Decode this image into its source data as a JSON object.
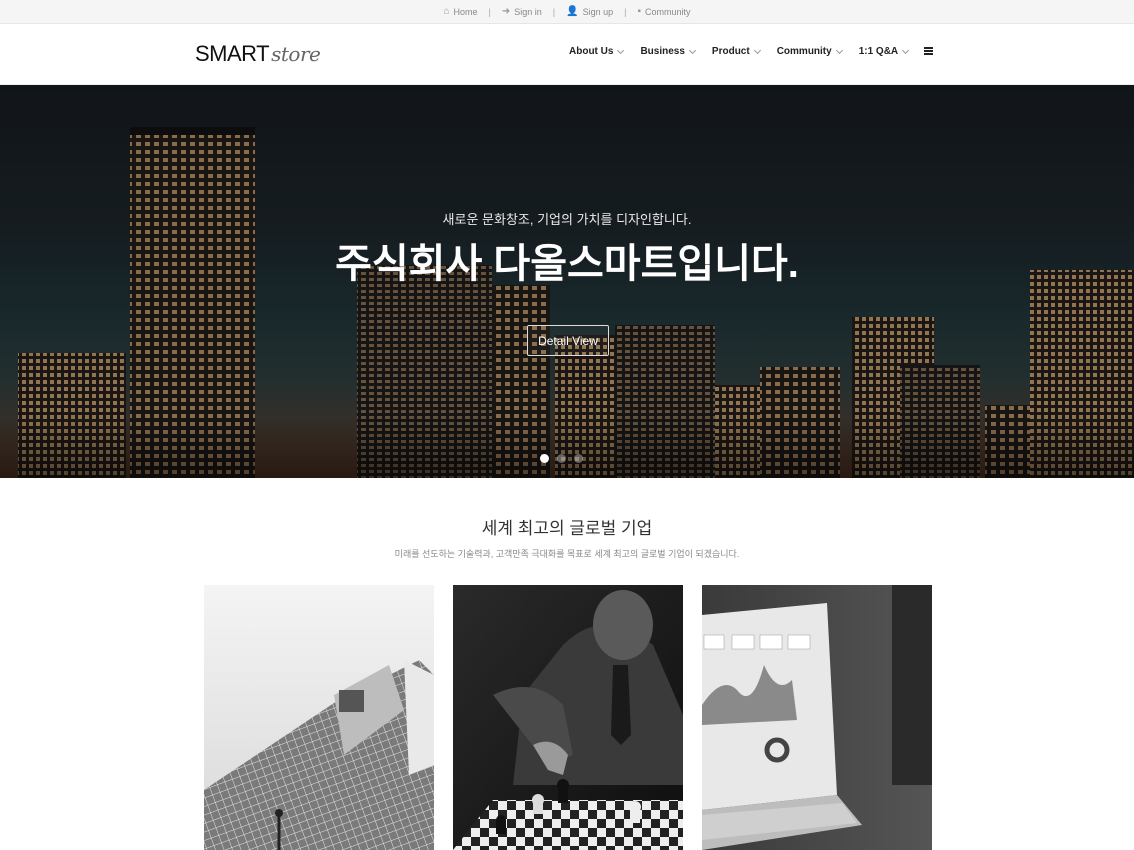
{
  "topbar": {
    "items": [
      {
        "label": "Home",
        "icon": "home-icon"
      },
      {
        "label": "Sign in",
        "icon": "sign-in-icon"
      },
      {
        "label": "Sign up",
        "icon": "user-plus-icon"
      },
      {
        "label": "Community",
        "icon": "comment-icon"
      }
    ],
    "separator": "|"
  },
  "header": {
    "logo_main": "SMART",
    "logo_sub": "store",
    "nav": [
      {
        "label": "About Us"
      },
      {
        "label": "Business"
      },
      {
        "label": "Product"
      },
      {
        "label": "Community"
      },
      {
        "label": "1:1 Q&A"
      }
    ],
    "menu_icon": "hamburger-menu-icon"
  },
  "hero": {
    "subtitle": "새로운 문화창조, 기업의 가치를 디자인합니다.",
    "title": "주식회사 다올스마트입니다.",
    "button_label": "Detail View",
    "active_slide": 1,
    "slide_count": 3
  },
  "section": {
    "title": "세계 최고의 글로벌 기업",
    "description": "미래를 선도하는 기술력과, 고객만족 극대화를 목표로 세계 최고의 글로벌 기업이 되겠습니다."
  },
  "cards": [
    {
      "image": "modern-building-photo"
    },
    {
      "image": "chess-businessman-photo"
    },
    {
      "image": "laptop-dashboard-photo"
    }
  ],
  "colors": {
    "topbar_bg": "#f5f5f5",
    "hero_overlay": "#1a2227",
    "text_dark": "#222222"
  }
}
